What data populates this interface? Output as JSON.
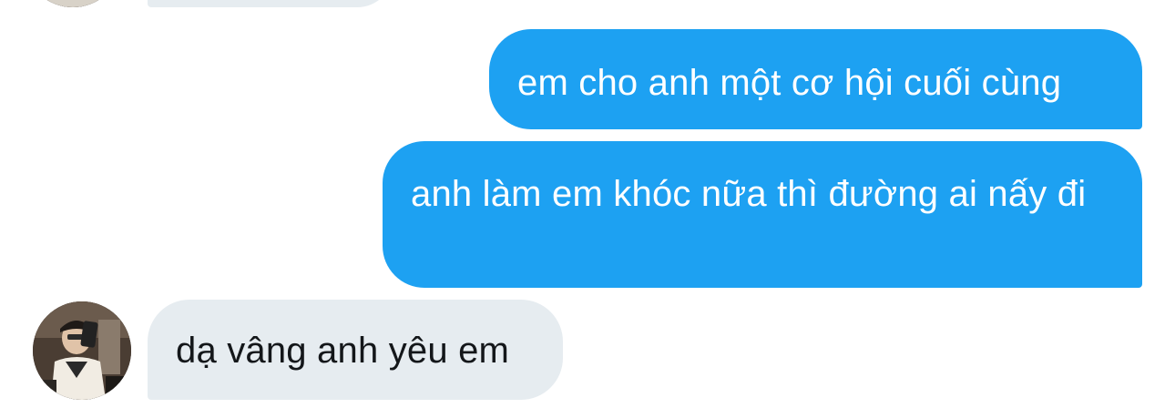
{
  "conversation": {
    "messages": [
      {
        "direction": "incoming",
        "text": ""
      },
      {
        "direction": "outgoing",
        "text": "em cho anh một cơ hội cuối cùng"
      },
      {
        "direction": "outgoing",
        "text": "anh làm em khóc nữa thì đường ai nấy đi"
      },
      {
        "direction": "incoming",
        "text": "dạ vâng anh yêu em"
      }
    ]
  },
  "colors": {
    "outgoing_bubble": "#1da1f2",
    "incoming_bubble": "#e6ecf0",
    "outgoing_text": "#ffffff",
    "incoming_text": "#14171a",
    "background": "#ffffff"
  },
  "icons": {
    "avatar": "user-avatar-photo"
  }
}
